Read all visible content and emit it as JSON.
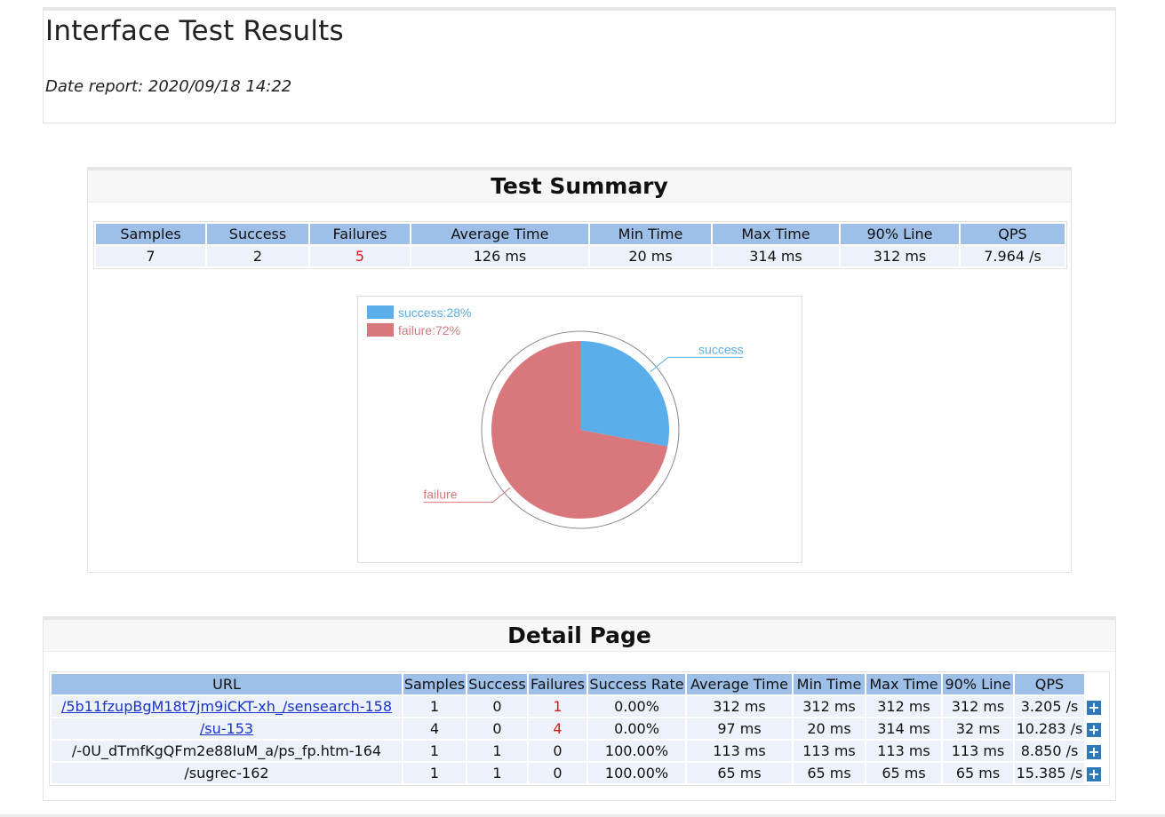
{
  "header": {
    "title": "Interface Test Results",
    "date_report": "Date report: 2020/09/18 14:22"
  },
  "summary": {
    "heading": "Test Summary",
    "columns": [
      "Samples",
      "Success",
      "Failures",
      "Average Time",
      "Min Time",
      "Max Time",
      "90% Line",
      "QPS"
    ],
    "values": [
      "7",
      "2",
      "5",
      "126 ms",
      "20 ms",
      "314 ms",
      "312 ms",
      "7.964 /s"
    ]
  },
  "chart_data": {
    "type": "pie",
    "title": "",
    "categories": [
      "success",
      "failure"
    ],
    "values": [
      28,
      72
    ],
    "legend": [
      "success:28%",
      "failure:72%"
    ],
    "legend_position": "top-left",
    "colors": [
      "#5aaeea",
      "#d8787c"
    ]
  },
  "detail": {
    "heading": "Detail Page",
    "columns": [
      "URL",
      "Samples",
      "Success",
      "Failures",
      "Success Rate",
      "Average Time",
      "Min Time",
      "Max Time",
      "90% Line",
      "QPS"
    ],
    "rows": [
      {
        "url": "/5b11fzupBgM18t7jm9iCKT-xh_/sensearch-158",
        "is_link": true,
        "samples": "1",
        "success": "0",
        "failures": "1",
        "rate": "0.00%",
        "avg": "312 ms",
        "min": "312 ms",
        "max": "312 ms",
        "p90": "312 ms",
        "qps": "3.205 /s"
      },
      {
        "url": "/su-153",
        "is_link": true,
        "samples": "4",
        "success": "0",
        "failures": "4",
        "rate": "0.00%",
        "avg": "97 ms",
        "min": "20 ms",
        "max": "314 ms",
        "p90": "32 ms",
        "qps": "10.283 /s"
      },
      {
        "url": "/-0U_dTmfKgQFm2e88IuM_a/ps_fp.htm-164",
        "is_link": false,
        "samples": "1",
        "success": "1",
        "failures": "0",
        "rate": "100.00%",
        "avg": "113 ms",
        "min": "113 ms",
        "max": "113 ms",
        "p90": "113 ms",
        "qps": "8.850 /s"
      },
      {
        "url": "/sugrec-162",
        "is_link": false,
        "samples": "1",
        "success": "1",
        "failures": "0",
        "rate": "100.00%",
        "avg": "65 ms",
        "min": "65 ms",
        "max": "65 ms",
        "p90": "65 ms",
        "qps": "15.385 /s"
      }
    ],
    "expand_symbol": "+"
  },
  "colors": {
    "header_cell": "#9dbfe8",
    "data_cell": "#edf2fa",
    "failure_text": "#d7191c",
    "link": "#1a33cc",
    "expand_button": "#2f79b9"
  }
}
